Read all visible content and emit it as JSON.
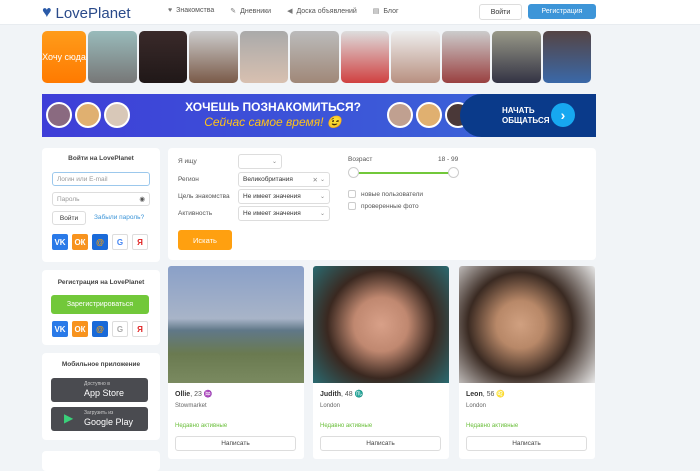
{
  "header": {
    "logo": "LovePlanet",
    "nav": [
      {
        "icon": "heart-icon",
        "label": "Знакомства"
      },
      {
        "icon": "pencil-icon",
        "label": "Дневники"
      },
      {
        "icon": "megaphone-icon",
        "label": "Доска объявлений"
      },
      {
        "icon": "document-icon",
        "label": "Блог"
      }
    ],
    "login": "Войти",
    "register": "Регистрация"
  },
  "strip": {
    "cta": "Хочу сюда"
  },
  "banner": {
    "title": "ХОЧЕШЬ ПОЗНАКОМИТЬСЯ?",
    "subtitle": "Сейчас самое время! 😉",
    "cta": "НАЧАТЬ ОБЩАТЬСЯ"
  },
  "login": {
    "title": "Войти на LovePlanet",
    "login_placeholder": "Логин или E-mail",
    "password_placeholder": "Пароль",
    "submit": "Войти",
    "forgot": "Забыли пароль?"
  },
  "social": {
    "vk": "VK",
    "ok": "ОК",
    "mail": "@",
    "google": "G",
    "yandex": "Я"
  },
  "registration": {
    "title": "Регистрация на LovePlanet",
    "button": "Зарегистрироваться"
  },
  "mobile": {
    "title": "Мобильное приложение",
    "appstore_small": "Доступно в",
    "appstore": "App Store",
    "gplay_small": "Загрузить из",
    "gplay": "Google Play"
  },
  "search": {
    "seeking_label": "Я ищу",
    "seeking_value": "",
    "region_label": "Регион",
    "region_value": "Великобритания",
    "goal_label": "Цель знакомства",
    "goal_value": "Не имеет значения",
    "activity_label": "Активность",
    "activity_value": "Не имеет значения",
    "age_label": "Возраст",
    "age_range": "18 - 99",
    "age_min": 18,
    "age_max": 99,
    "new_users": "новые пользователи",
    "verified": "проверенные фото",
    "submit": "Искать"
  },
  "profiles": [
    {
      "name": "Ollie",
      "age": ", 23",
      "zodiac": "♒",
      "city": "Stowmarket",
      "status": "Недавно активные",
      "action": "Написать"
    },
    {
      "name": "Judith",
      "age": ", 48",
      "zodiac": "♏",
      "city": "London",
      "status": "Недавно активные",
      "action": "Написать"
    },
    {
      "name": "Leon",
      "age": ", 56",
      "zodiac": "♌",
      "city": "London",
      "status": "Недавно активные",
      "action": "Написать"
    }
  ]
}
